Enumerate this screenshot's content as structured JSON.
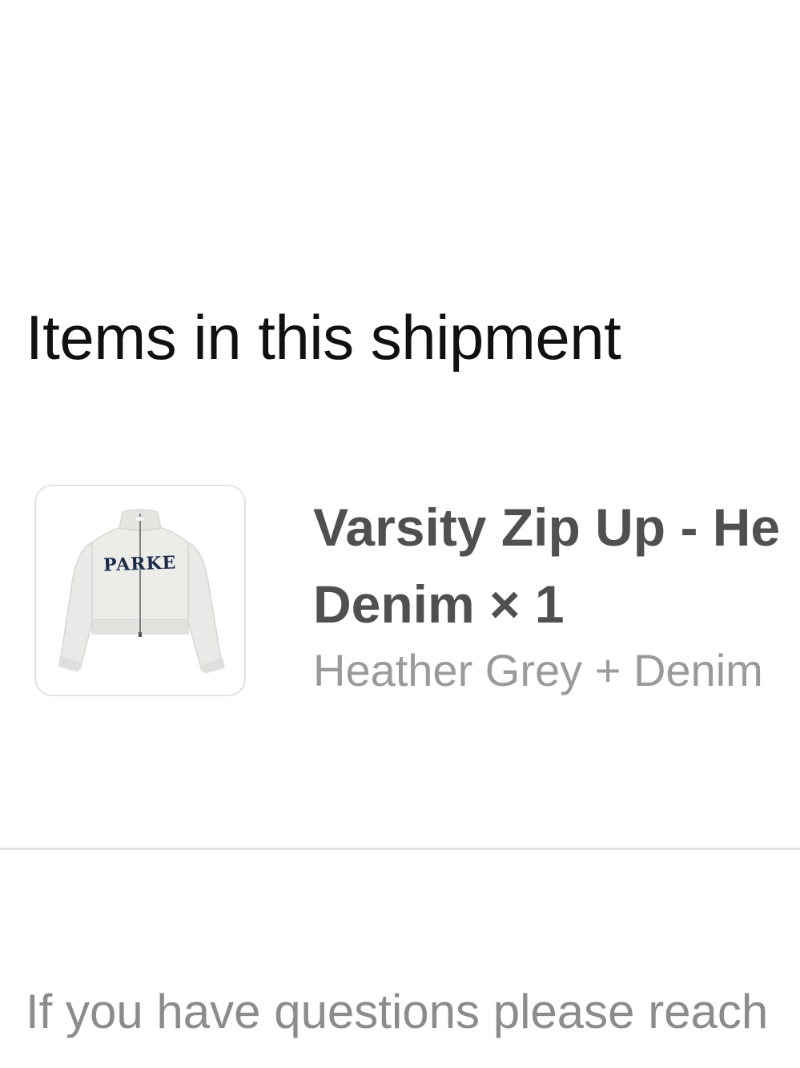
{
  "shipment": {
    "title": "Items in this shipment"
  },
  "items": [
    {
      "name_line1": "Varsity Zip Up - He",
      "name_line2": "Denim × 1",
      "variant": "Heather Grey + Denim",
      "image_icon": "cropped-zip-jacket-icon",
      "image_wordmark": "PARKE"
    }
  ],
  "footer": {
    "text": "If you have questions please reach"
  },
  "colors": {
    "title": "#111111",
    "item_name": "#505050",
    "variant": "#9a9a9a",
    "footer": "#8c8c8c",
    "divider": "#e2e2e2",
    "jacket": "#e9e9e7",
    "wordmark": "#1c2a4a"
  }
}
